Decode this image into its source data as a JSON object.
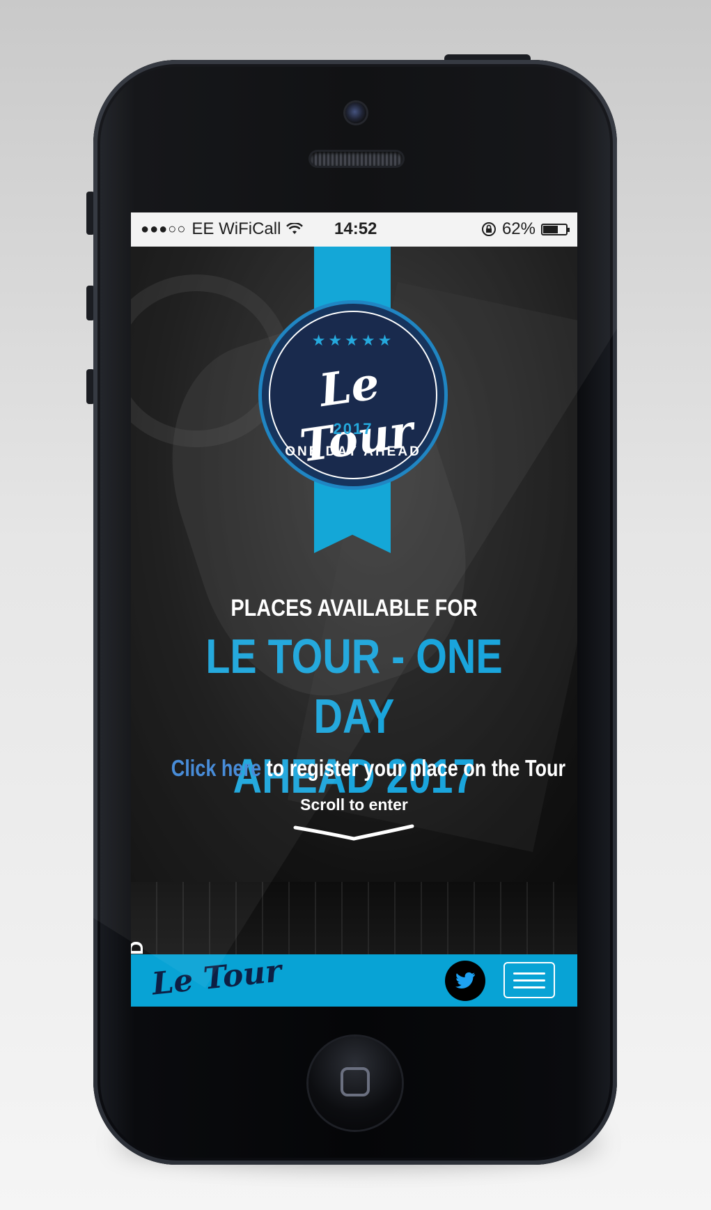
{
  "status_bar": {
    "signal": "●●●○○",
    "carrier": "EE WiFiCall",
    "time": "14:52",
    "battery_percent": "62%",
    "battery_level": 0.62
  },
  "hero": {
    "badge": {
      "stars": "★★★★★",
      "logo": "Le Tour",
      "year": "2017",
      "subtitle": "ONE DAY AHEAD"
    },
    "heading_small": "PLACES AVAILABLE FOR",
    "heading_large_line1": "LE TOUR - ONE DAY",
    "heading_large_line2": "AHEAD 2017",
    "cta_link": "Click here",
    "cta_text": " to register your place on the Tour",
    "scroll_label": "Scroll to enter"
  },
  "strip": {
    "side_text": "HOD"
  },
  "navbar": {
    "logo": "Le Tour",
    "twitter_icon": "twitter-icon",
    "menu_icon": "hamburger-menu-icon"
  },
  "colors": {
    "accent": "#08a3d5",
    "navy": "#0d1f44",
    "link": "#3f86d6"
  }
}
